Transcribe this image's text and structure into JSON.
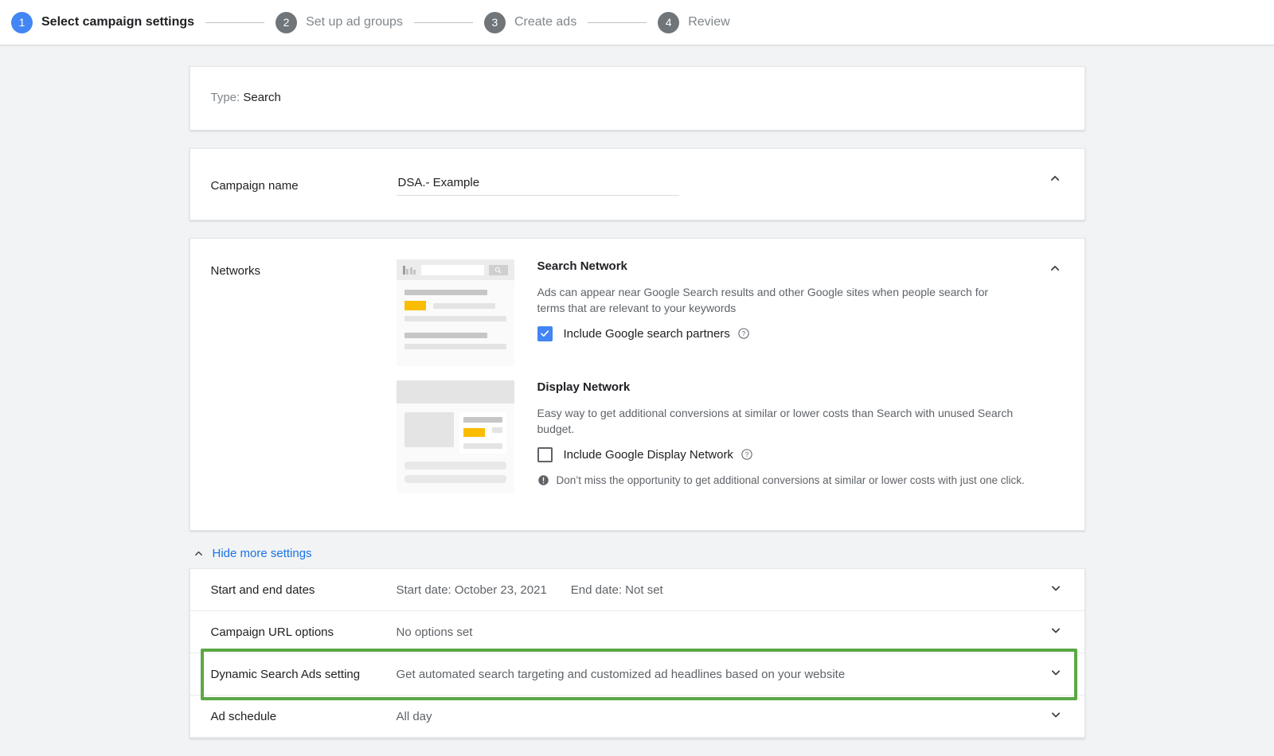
{
  "stepper": {
    "steps": [
      {
        "num": "1",
        "label": "Select campaign settings",
        "state": "active"
      },
      {
        "num": "2",
        "label": "Set up ad groups",
        "state": "inactive"
      },
      {
        "num": "3",
        "label": "Create ads",
        "state": "inactive"
      },
      {
        "num": "4",
        "label": "Review",
        "state": "inactive"
      }
    ]
  },
  "type_card": {
    "label": "Type:",
    "value": "Search"
  },
  "campaign_name": {
    "label": "Campaign name",
    "value": "DSA.- Example"
  },
  "networks": {
    "label": "Networks",
    "search": {
      "title": "Search Network",
      "description": "Ads can appear near Google Search results and other Google sites when people search for terms that are relevant to your keywords",
      "checkbox_label": "Include Google search partners",
      "checked": true,
      "help_icon": "help-circle-icon"
    },
    "display": {
      "title": "Display Network",
      "description": "Easy way to get additional conversions at similar or lower costs than Search with unused Search budget.",
      "checkbox_label": "Include Google Display Network",
      "checked": false,
      "help_icon": "help-circle-icon",
      "warning_icon": "exclamation-circle-icon",
      "warning_text": "Don’t miss the opportunity to get additional conversions at similar or lower costs with just one click."
    }
  },
  "hide_more_settings": {
    "label": "Hide more settings",
    "icon": "chevron-up-icon"
  },
  "settings_rows": [
    {
      "label": "Start and end dates",
      "value": "Start date: October 23, 2021",
      "value2": "End date: Not set",
      "highlighted": false
    },
    {
      "label": "Campaign URL options",
      "value": "No options set",
      "value2": "",
      "highlighted": false
    },
    {
      "label": "Dynamic Search Ads setting",
      "value": "Get automated search targeting and customized ad headlines based on your website",
      "value2": "",
      "highlighted": true
    },
    {
      "label": "Ad schedule",
      "value": "All day",
      "value2": "",
      "highlighted": false
    }
  ],
  "colors": {
    "accent_blue": "#4285f4",
    "link_blue": "#1a73e8",
    "highlight_green": "#5aa845",
    "ad_badge_yellow": "#fbbc04",
    "page_background": "#f1f3f4"
  },
  "icons": {
    "collapse": "chevron-up-icon",
    "expand": "chevron-down-icon",
    "search": "search-icon"
  }
}
